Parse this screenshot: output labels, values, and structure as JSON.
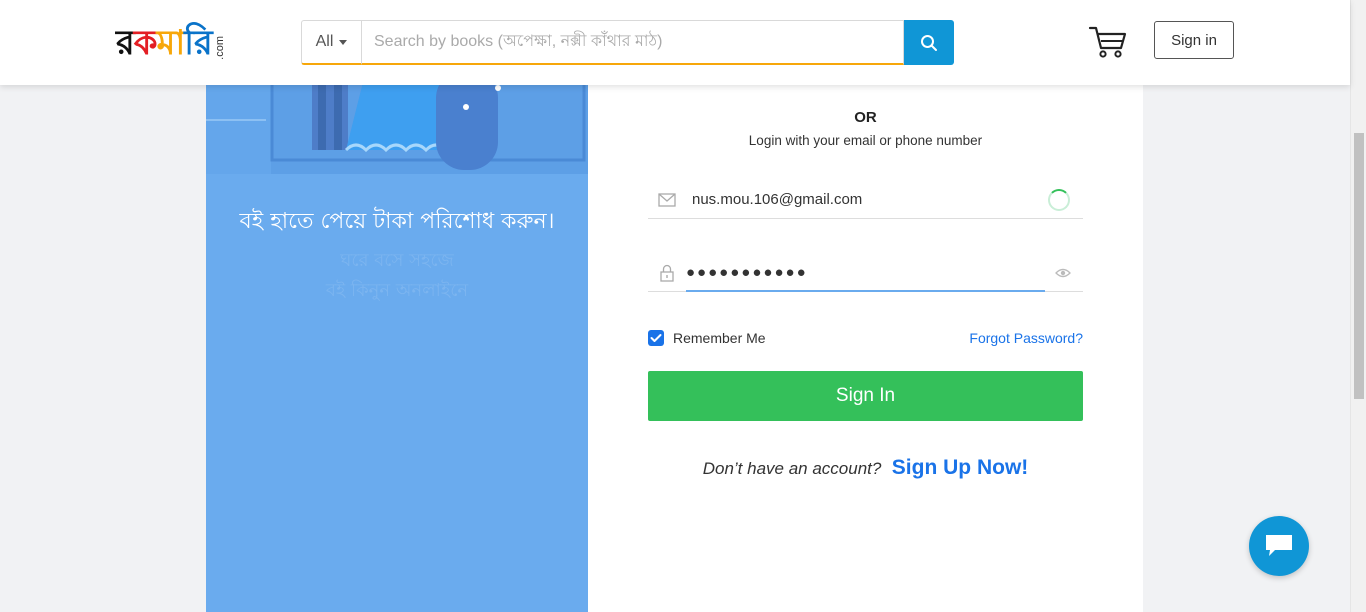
{
  "header": {
    "logo": {
      "part1": "র",
      "part2": "ক",
      "part3": "মা",
      "part4": "রি",
      "suffix": ".com"
    },
    "search": {
      "category_label": "All",
      "placeholder": "Search by books (অপেক্ষা, নক্সী কাঁথার মাঠ)",
      "accent": "#f7a70a",
      "button_color": "#1096d6"
    },
    "signin_label": "Sign in"
  },
  "promo": {
    "tagline": "বই হাতে পেয়ে টাকা পরিশোধ করুন।",
    "faded_line1": "ঘরে বসে সহজে",
    "faded_line2": "বই কিনুন অনলাইনে",
    "background": "#6aabee"
  },
  "login": {
    "or_text": "OR",
    "subtitle": "Login with your email or phone number",
    "email_value": "nus.mou.106@gmail.com",
    "password_value": "●●●●●●●●●●●",
    "remember_label": "Remember Me",
    "remember_checked": true,
    "forgot_label": "Forgot Password?",
    "signin_button": "Sign In",
    "signin_color": "#34c05a",
    "no_account_text": "Don’t have an account?",
    "signup_link": "Sign Up Now!"
  }
}
